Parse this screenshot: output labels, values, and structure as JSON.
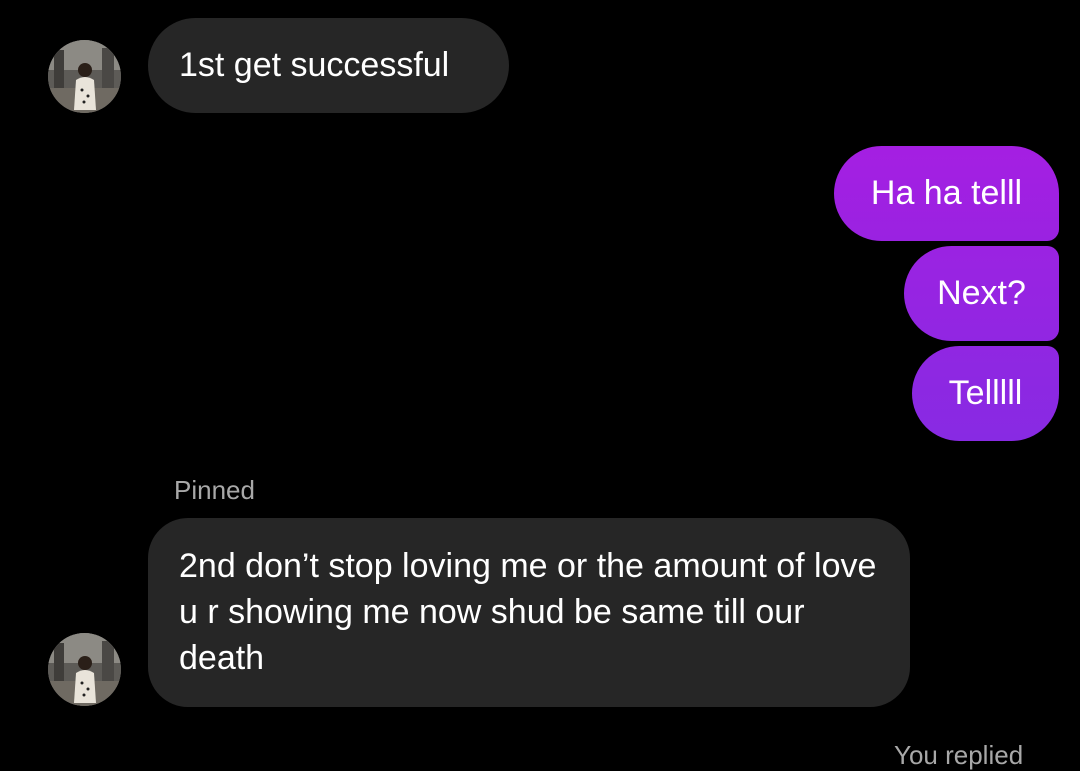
{
  "conversation": {
    "incoming_first": {
      "text": "1st get successful"
    },
    "outgoing": [
      {
        "text": "Ha ha telll"
      },
      {
        "text": "Next?"
      },
      {
        "text": "Telllll"
      }
    ],
    "pinned_label": "Pinned",
    "incoming_pinned": {
      "text": "2nd don’t stop loving me or the amount of love u r showing me now shud be same till our death"
    },
    "reply_status": "You replied"
  },
  "colors": {
    "background": "#000000",
    "incoming_bubble": "#262626",
    "outgoing_gradient_top": "#a11ee0",
    "outgoing_gradient_bottom": "#8a2be2",
    "meta_text": "#a8a8a8"
  },
  "icons": {
    "avatar": "profile-photo"
  }
}
